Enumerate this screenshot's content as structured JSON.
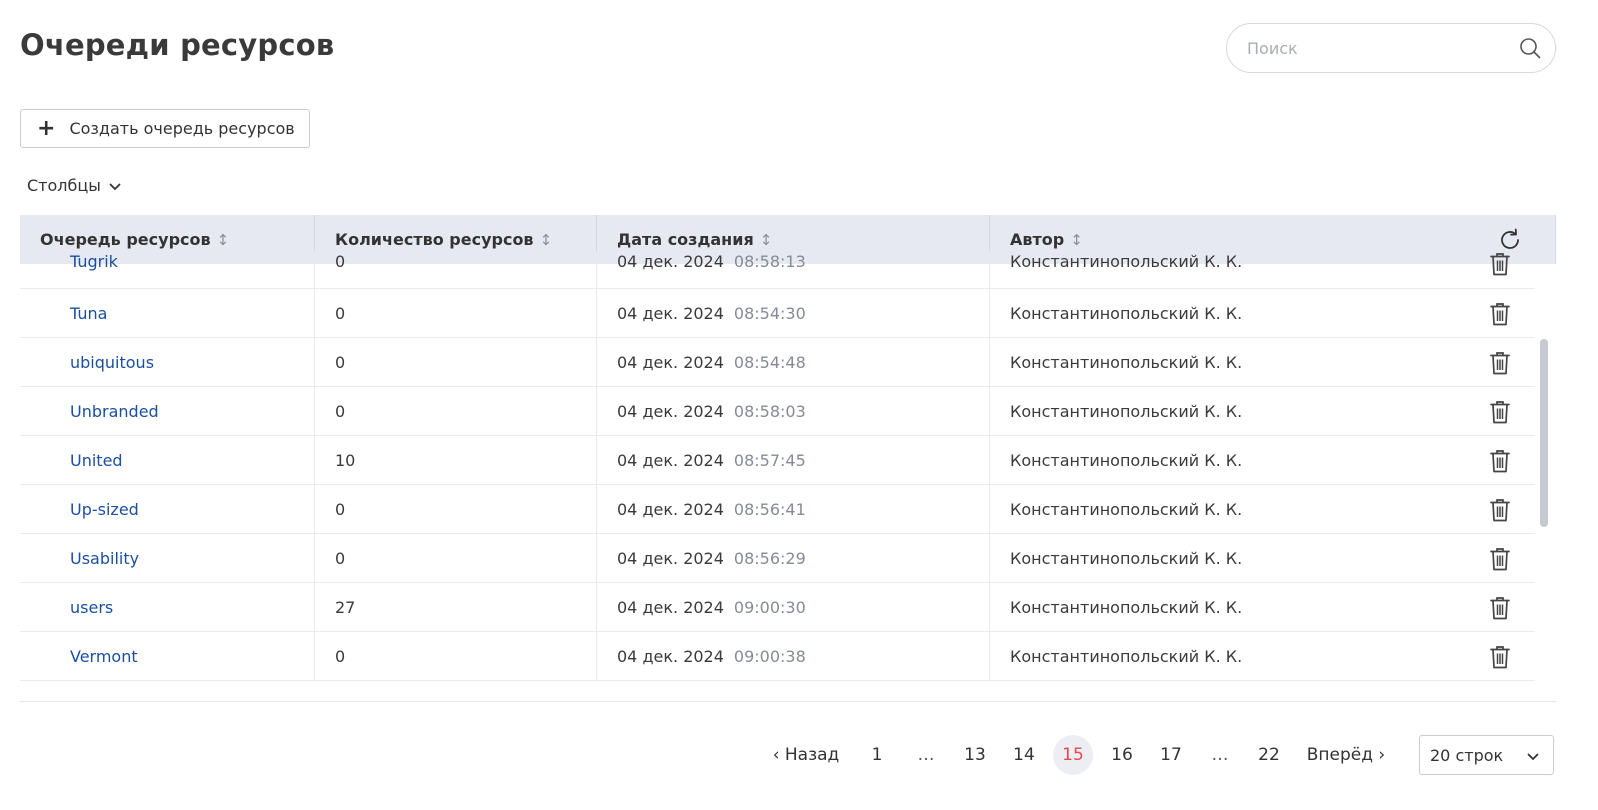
{
  "header": {
    "title": "Очереди ресурсов",
    "search_placeholder": "Поиск"
  },
  "toolbar": {
    "create_label": "Создать очередь ресурсов",
    "columns_label": "Столбцы"
  },
  "table": {
    "columns": [
      "Очередь ресурсов",
      "Количество ресурсов",
      "Дата создания",
      "Автор"
    ],
    "rows": [
      {
        "name": "Tugrik",
        "count": "0",
        "date": "04 дек. 2024",
        "time": "08:58:13",
        "author": "Константинопольский К. К."
      },
      {
        "name": "Tuna",
        "count": "0",
        "date": "04 дек. 2024",
        "time": "08:54:30",
        "author": "Константинопольский К. К."
      },
      {
        "name": "ubiquitous",
        "count": "0",
        "date": "04 дек. 2024",
        "time": "08:54:48",
        "author": "Константинопольский К. К."
      },
      {
        "name": "Unbranded",
        "count": "0",
        "date": "04 дек. 2024",
        "time": "08:58:03",
        "author": "Константинопольский К. К."
      },
      {
        "name": "United",
        "count": "10",
        "date": "04 дек. 2024",
        "time": "08:57:45",
        "author": "Константинопольский К. К."
      },
      {
        "name": "Up-sized",
        "count": "0",
        "date": "04 дек. 2024",
        "time": "08:56:41",
        "author": "Константинопольский К. К."
      },
      {
        "name": "Usability",
        "count": "0",
        "date": "04 дек. 2024",
        "time": "08:56:29",
        "author": "Константинопольский К. К."
      },
      {
        "name": "users",
        "count": "27",
        "date": "04 дек. 2024",
        "time": "09:00:30",
        "author": "Константинопольский К. К."
      },
      {
        "name": "Vermont",
        "count": "0",
        "date": "04 дек. 2024",
        "time": "09:00:38",
        "author": "Константинопольский К. К."
      }
    ]
  },
  "pagination": {
    "prev_label": "‹ Назад",
    "next_label": "Вперёд ›",
    "pages": [
      "1",
      "…",
      "13",
      "14",
      "15",
      "16",
      "17",
      "…",
      "22"
    ],
    "current": "15",
    "rows_per_page": "20 строк"
  },
  "colors": {
    "link": "#1b4fa0",
    "active_page": "#e5484d",
    "header_bg": "#e6e9f1"
  }
}
